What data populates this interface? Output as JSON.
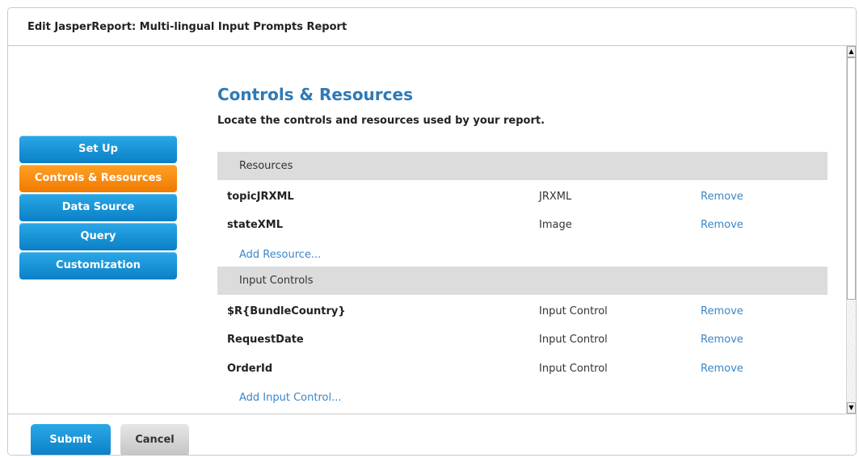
{
  "panel": {
    "title": "Edit JasperReport: Multi-lingual Input Prompts Report"
  },
  "nav": {
    "items": [
      {
        "label": "Set Up",
        "active": false
      },
      {
        "label": "Controls & Resources",
        "active": true
      },
      {
        "label": "Data Source",
        "active": false
      },
      {
        "label": "Query",
        "active": false
      },
      {
        "label": "Customization",
        "active": false
      }
    ]
  },
  "main": {
    "title": "Controls & Resources",
    "description": "Locate the controls and resources used by your report.",
    "resources": {
      "header": "Resources",
      "rows": [
        {
          "name": "topicJRXML",
          "type": "JRXML",
          "action": "Remove"
        },
        {
          "name": "stateXML",
          "type": "Image",
          "action": "Remove"
        }
      ],
      "add_link": "Add Resource..."
    },
    "input_controls": {
      "header": "Input Controls",
      "rows": [
        {
          "name": "$R{BundleCountry}",
          "type": "Input Control",
          "action": "Remove"
        },
        {
          "name": "RequestDate",
          "type": "Input Control",
          "action": "Remove"
        },
        {
          "name": "OrderId",
          "type": "Input Control",
          "action": "Remove"
        }
      ],
      "add_link": "Add Input Control..."
    }
  },
  "footer": {
    "submit_label": "Submit",
    "cancel_label": "Cancel"
  },
  "colors": {
    "accent_blue": "#1b93d9",
    "active_orange": "#f58a0f",
    "link": "#3a86c8",
    "title": "#2f79b6"
  }
}
